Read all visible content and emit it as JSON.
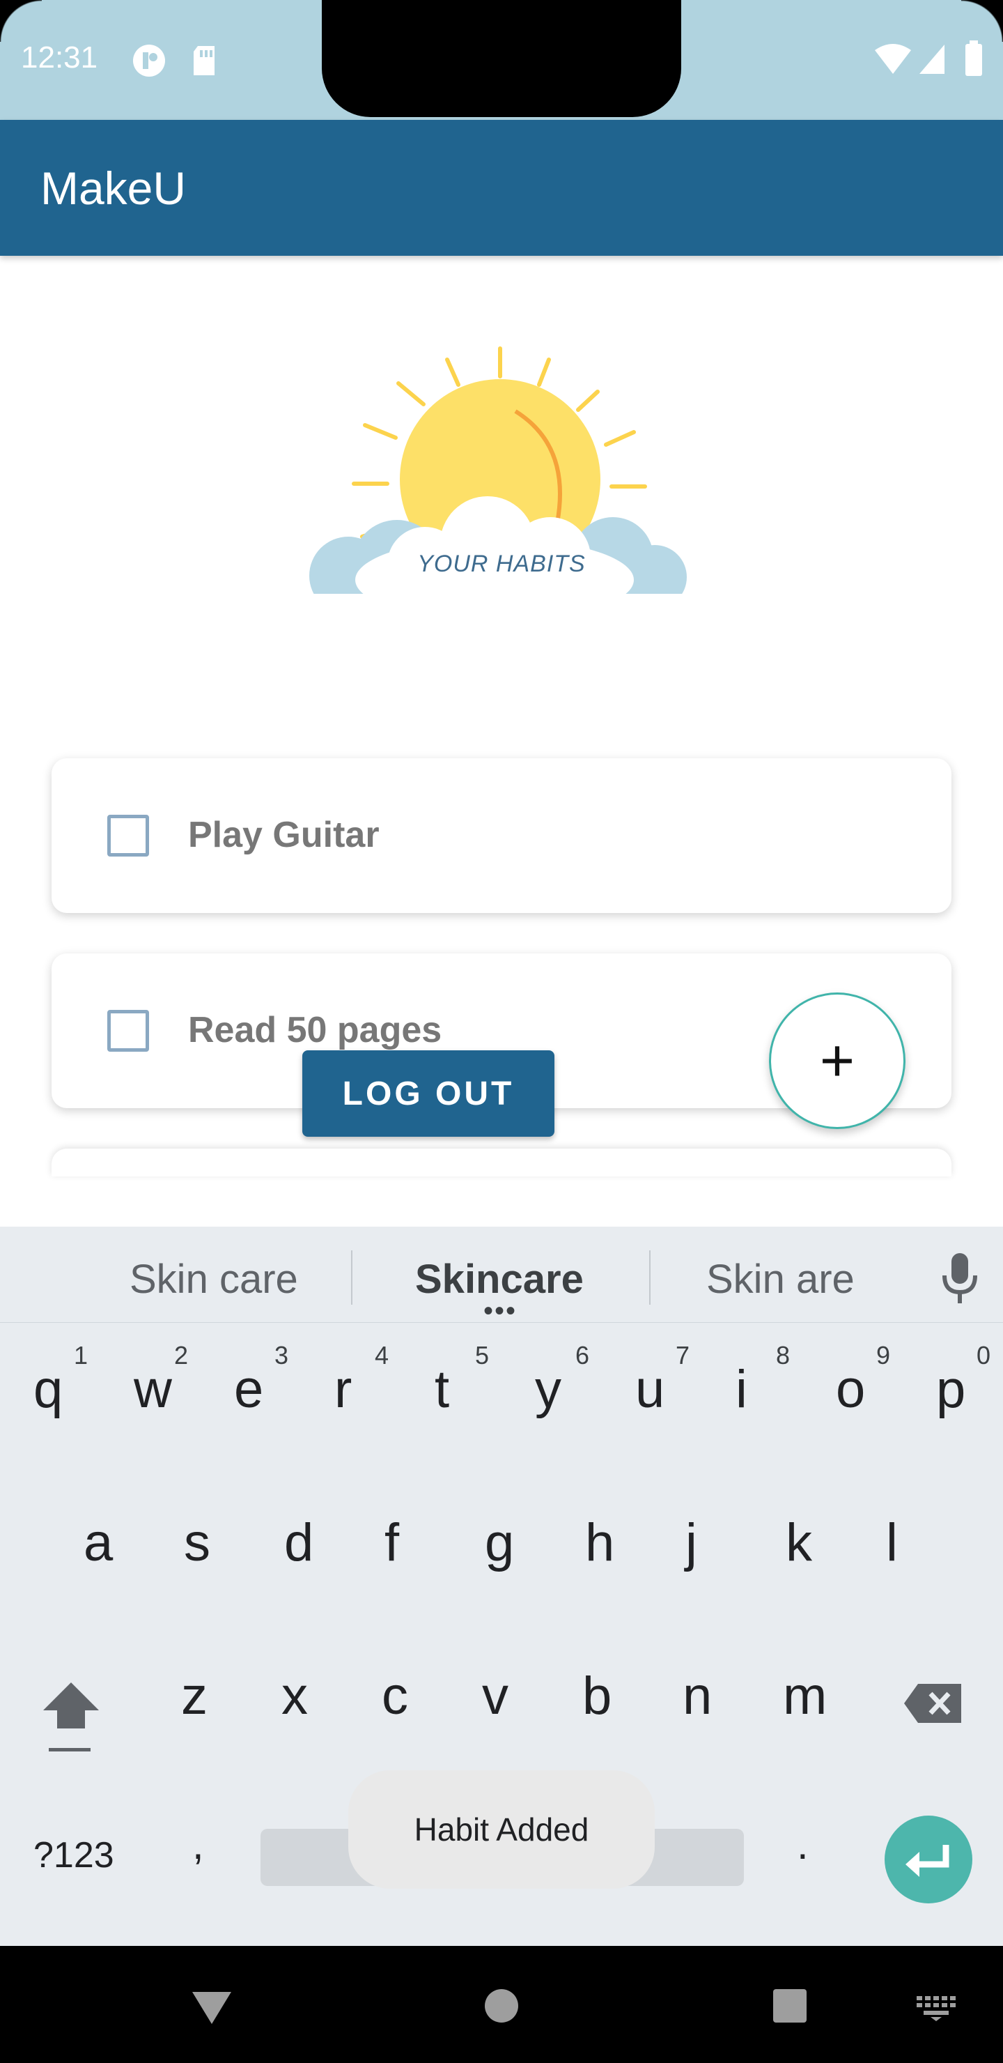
{
  "status_bar": {
    "time": "12:31"
  },
  "app_bar": {
    "title": "MakeU"
  },
  "hero": {
    "text": "YOUR HABITS"
  },
  "habits": [
    {
      "label": "Play Guitar",
      "checked": false
    },
    {
      "label": "Read 50 pages",
      "checked": false
    }
  ],
  "fab": {
    "icon": "+"
  },
  "logout": {
    "label": "LOG OUT"
  },
  "keyboard": {
    "suggestions": [
      "Skin care",
      "Skincare",
      "Skin are"
    ],
    "row1": [
      "q",
      "w",
      "e",
      "r",
      "t",
      "y",
      "u",
      "i",
      "o",
      "p"
    ],
    "row1_hints": [
      "1",
      "2",
      "3",
      "4",
      "5",
      "6",
      "7",
      "8",
      "9",
      "0"
    ],
    "row2": [
      "a",
      "s",
      "d",
      "f",
      "g",
      "h",
      "j",
      "k",
      "l"
    ],
    "row3": [
      "z",
      "x",
      "c",
      "v",
      "b",
      "n",
      "m"
    ],
    "symbols_label": "?123",
    "comma": ",",
    "period": "."
  },
  "toast": {
    "text": "Habit Added"
  },
  "colors": {
    "primary": "#20648f",
    "accent": "#4db6ac",
    "status_bar": "#b0d3df"
  }
}
